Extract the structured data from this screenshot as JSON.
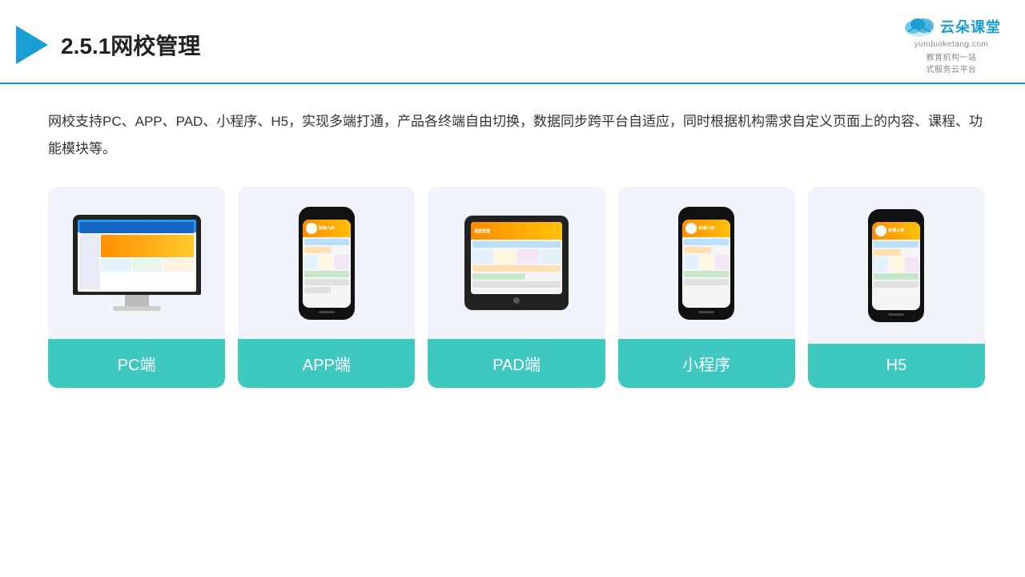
{
  "header": {
    "title": "2.5.1网校管理",
    "logo": {
      "main": "云朵课堂",
      "domain": "yunduoketang.com",
      "tagline": "教育机构一站\n式服务云平台"
    }
  },
  "description": "网校支持PC、APP、PAD、小程序、H5，实现多端打通，产品各终端自由切换，数据同步跨平台自适应，同时根据机构需求自定义页面上的内容、课程、功能模块等。",
  "cards": [
    {
      "id": "pc",
      "label": "PC端",
      "device": "monitor"
    },
    {
      "id": "app",
      "label": "APP端",
      "device": "phone"
    },
    {
      "id": "pad",
      "label": "PAD端",
      "device": "tablet"
    },
    {
      "id": "mini",
      "label": "小程序",
      "device": "phone"
    },
    {
      "id": "h5",
      "label": "H5",
      "device": "phone"
    }
  ],
  "accent_color": "#3ec8c0"
}
